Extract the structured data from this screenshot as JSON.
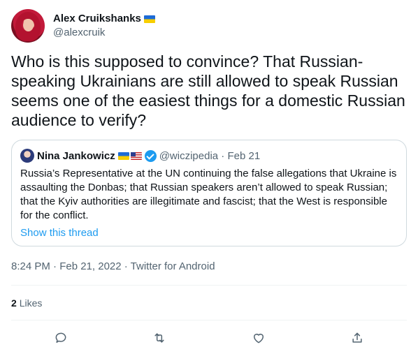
{
  "author": {
    "display_name": "Alex Cruikshanks",
    "handle": "@alexcruik",
    "flag_icon": "ukraine-flag-icon"
  },
  "tweet": {
    "text": "Who is this supposed to convince? That Russian-speaking Ukrainians are still allowed to speak Russian seems one of the easiest things for a domestic Russian audience to verify?"
  },
  "quoted": {
    "display_name": "Nina Jankowicz",
    "flags": [
      "ukraine-flag-icon",
      "us-flag-icon"
    ],
    "verified_icon": "verified-badge-icon",
    "handle_date": "@wiczipedia · Feb 21",
    "text": "Russia’s Representative at the UN continuing the false allegations that Ukraine is assaulting the Donbas; that Russian speakers aren’t allowed to speak Russian; that the Kyiv authorities are illegitimate and fascist; that the West is responsible for the conflict.",
    "thread_link": "Show this thread"
  },
  "meta": {
    "timestamp": "8:24 PM · Feb 21, 2022 · Twitter for Android"
  },
  "stats": {
    "likes_count": "2",
    "likes_label": "Likes"
  },
  "actions": [
    "reply-icon",
    "retweet-icon",
    "like-icon",
    "share-icon"
  ],
  "colors": {
    "link": "#1d9bf0",
    "secondary_text": "#536471",
    "border": "#cfd9de"
  }
}
